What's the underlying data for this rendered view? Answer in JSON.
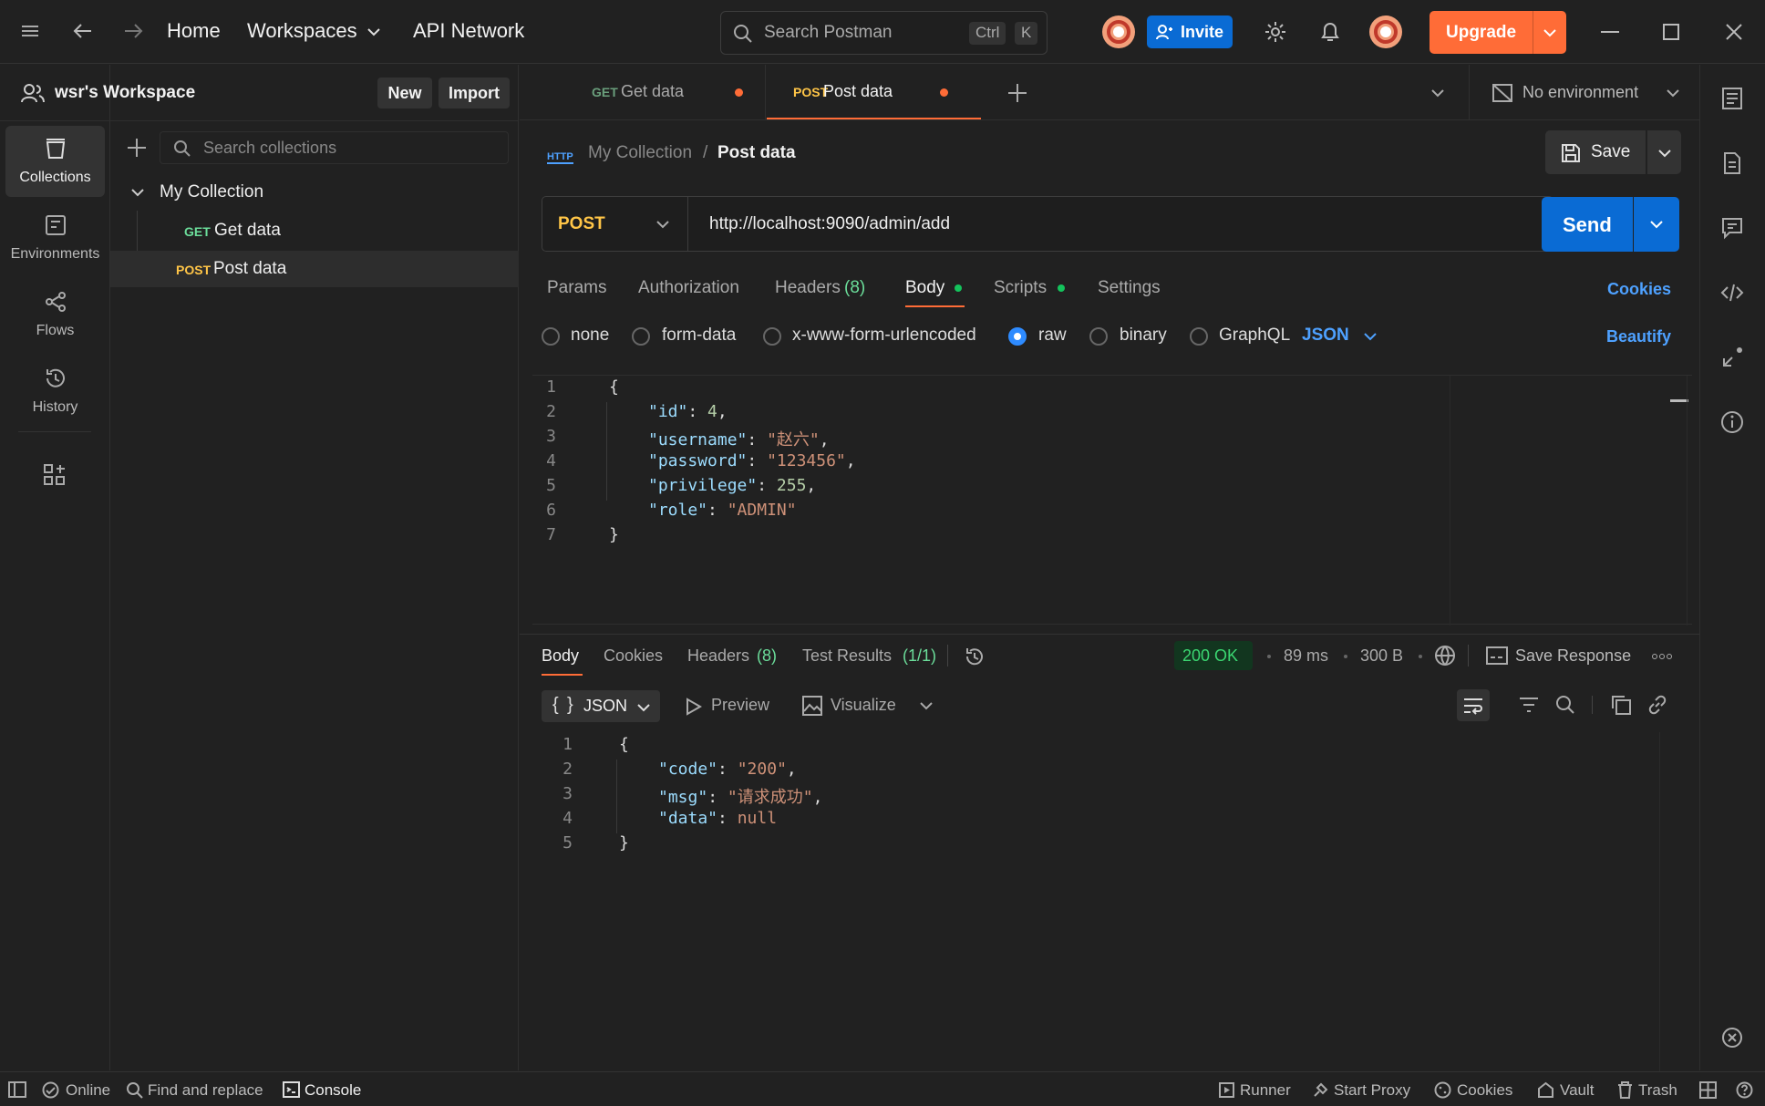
{
  "topbar": {
    "home": "Home",
    "workspaces": "Workspaces",
    "api_network": "API Network",
    "search_placeholder": "Search Postman",
    "kbd_ctrl": "Ctrl",
    "kbd_k": "K",
    "invite": "Invite",
    "upgrade": "Upgrade"
  },
  "workspace": {
    "name": "wsr's Workspace",
    "new_label": "New",
    "import_label": "Import"
  },
  "rail": {
    "items": [
      {
        "label": "Collections",
        "icon": "collections-icon"
      },
      {
        "label": "Environments",
        "icon": "environments-icon"
      },
      {
        "label": "Flows",
        "icon": "flows-icon"
      },
      {
        "label": "History",
        "icon": "history-icon"
      }
    ]
  },
  "sidebar": {
    "search_placeholder": "Search collections",
    "collection": "My Collection",
    "requests": [
      {
        "method": "GET",
        "name": "Get data"
      },
      {
        "method": "POST",
        "name": "Post data"
      }
    ]
  },
  "tabs": [
    {
      "method": "GET",
      "name": "Get data"
    },
    {
      "method": "POST",
      "name": "Post data"
    }
  ],
  "environment": "No environment",
  "breadcrumb": {
    "badge": "HTTP",
    "collection": "My Collection",
    "separator": "/",
    "request": "Post data"
  },
  "save_label": "Save",
  "request": {
    "method": "POST",
    "url": "http://localhost:9090/admin/add",
    "send": "Send"
  },
  "req_tabs": {
    "params": "Params",
    "authorization": "Authorization",
    "headers": "Headers",
    "headers_count": "(8)",
    "body": "Body",
    "scripts": "Scripts",
    "settings": "Settings",
    "cookies": "Cookies"
  },
  "body_types": {
    "none": "none",
    "form_data": "form-data",
    "urlencoded": "x-www-form-urlencoded",
    "raw": "raw",
    "binary": "binary",
    "graphql": "GraphQL",
    "format": "JSON",
    "beautify": "Beautify"
  },
  "request_body": {
    "line_numbers": [
      "1",
      "2",
      "3",
      "4",
      "5",
      "6",
      "7"
    ],
    "l1": "{",
    "id_key": "\"id\"",
    "id_val": "4",
    "username_key": "\"username\"",
    "username_val": "\"赵六\"",
    "password_key": "\"password\"",
    "password_val": "\"123456\"",
    "privilege_key": "\"privilege\"",
    "privilege_val": "255",
    "role_key": "\"role\"",
    "role_val": "\"ADMIN\"",
    "l7": "}"
  },
  "response": {
    "tabs": {
      "body": "Body",
      "cookies": "Cookies",
      "headers": "Headers",
      "headers_count": "(8)",
      "tests": "Test Results",
      "tests_count": "(1/1)"
    },
    "status": "200 OK",
    "time": "89 ms",
    "size": "300 B",
    "save_response": "Save Response",
    "view_format": "JSON",
    "preview": "Preview",
    "visualize": "Visualize",
    "line_numbers": [
      "1",
      "2",
      "3",
      "4",
      "5"
    ],
    "l1": "{",
    "code_key": "\"code\"",
    "code_val": "\"200\"",
    "msg_key": "\"msg\"",
    "msg_val": "\"请求成功\"",
    "data_key": "\"data\"",
    "data_val": "null",
    "l5": "}"
  },
  "statusbar": {
    "online": "Online",
    "find_replace": "Find and replace",
    "console": "Console",
    "runner": "Runner",
    "start_proxy": "Start Proxy",
    "cookies": "Cookies",
    "vault": "Vault",
    "trash": "Trash"
  },
  "colors": {
    "accent_orange": "#ff6c37",
    "blue": "#0a6bd4",
    "post": "#ffc547",
    "get": "#6bdd9a",
    "ok": "#14a34a"
  }
}
